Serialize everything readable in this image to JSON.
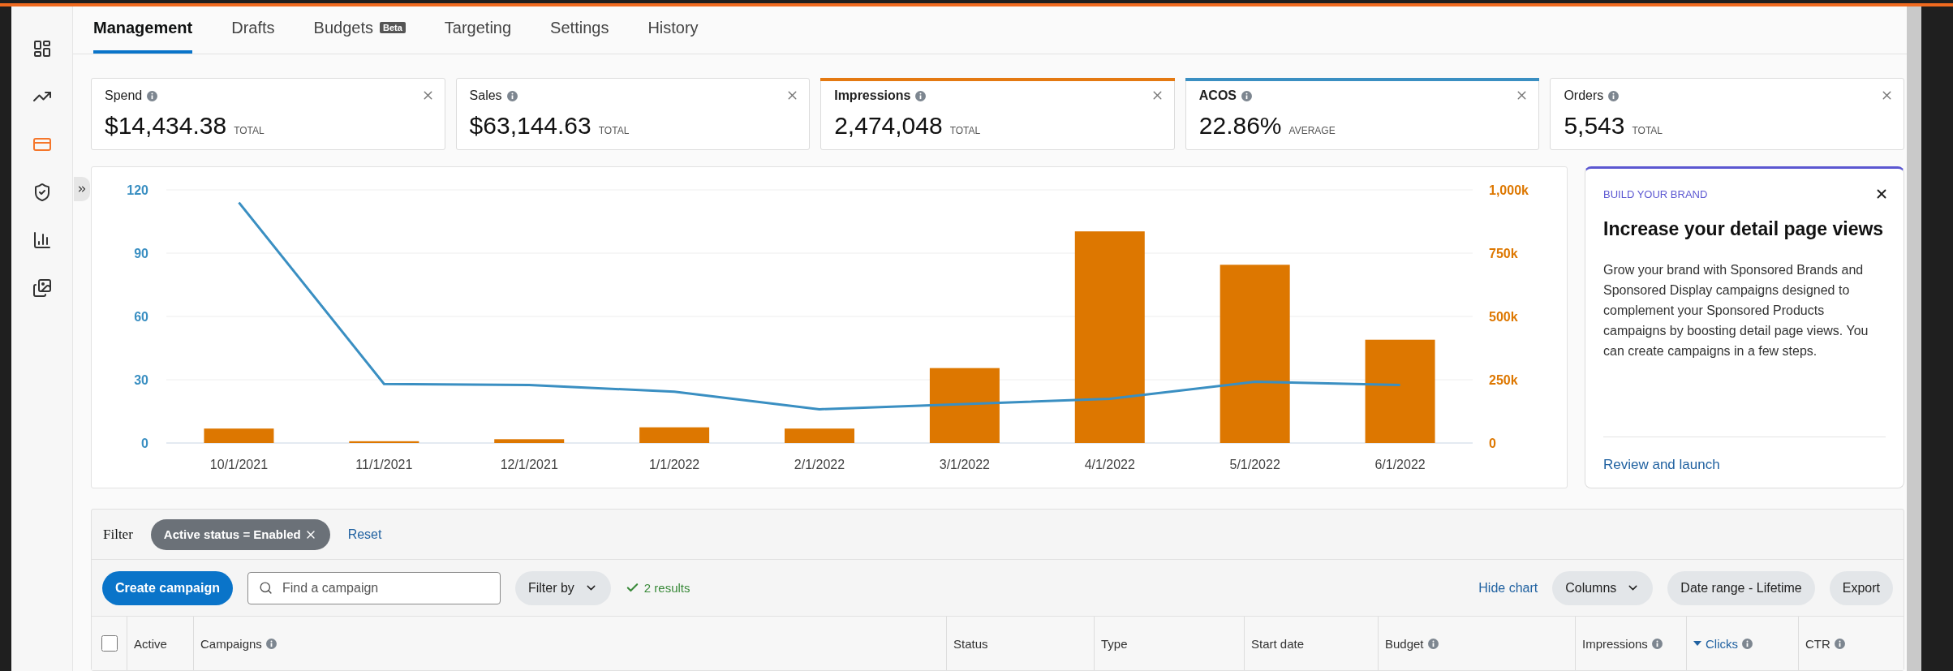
{
  "sidebar": {
    "items": [
      {
        "kind": "dashboard",
        "selected": false
      },
      {
        "kind": "trend",
        "selected": false
      },
      {
        "kind": "wallet",
        "selected": true
      },
      {
        "kind": "shield",
        "selected": false
      },
      {
        "kind": "bars",
        "selected": false
      },
      {
        "kind": "images",
        "selected": false
      }
    ]
  },
  "tabs": [
    {
      "label": "Management",
      "selected": true
    },
    {
      "label": "Drafts",
      "selected": false
    },
    {
      "label": "Budgets",
      "badge": "Beta",
      "selected": false
    },
    {
      "label": "Targeting",
      "selected": false
    },
    {
      "label": "Settings",
      "selected": false
    },
    {
      "label": "History",
      "selected": false
    }
  ],
  "metrics": [
    {
      "label": "Spend",
      "value": "$14,434.38",
      "unit": "TOTAL"
    },
    {
      "label": "Sales",
      "value": "$63,144.63",
      "unit": "TOTAL"
    },
    {
      "label": "Impressions",
      "value": "2,474,048",
      "unit": "TOTAL",
      "color": "#e47911"
    },
    {
      "label": "ACOS",
      "value": "22.86%",
      "unit": "AVERAGE",
      "color": "#3a8fc2"
    },
    {
      "label": "Orders",
      "value": "5,543",
      "unit": "TOTAL"
    }
  ],
  "chart": {
    "chart_data": {
      "type": "bar",
      "categories": [
        "10/1/2021",
        "11/1/2021",
        "12/1/2021",
        "1/1/2022",
        "2/1/2022",
        "3/1/2022",
        "4/1/2022",
        "5/1/2022",
        "6/1/2022"
      ],
      "series": [
        {
          "type": "bar",
          "axis": "y2",
          "color": "#dd7700",
          "values": [
            57000,
            7000,
            15000,
            62000,
            57000,
            296000,
            836000,
            704000,
            408000
          ]
        },
        {
          "type": "line",
          "axis": "y",
          "color": "#3a8fc2",
          "values": [
            114,
            28,
            27.5,
            24.3,
            16,
            18.5,
            21,
            29,
            27.5
          ]
        }
      ],
      "grid": true,
      "ylim": [
        0,
        120
      ],
      "y2lim": [
        0,
        1000000
      ],
      "yticks": [
        0,
        30,
        60,
        90,
        120
      ],
      "y2ticks": [
        {
          "value": 0,
          "label": "0"
        },
        {
          "value": 250000,
          "label": "250k"
        },
        {
          "value": 500000,
          "label": "500k"
        },
        {
          "value": 750000,
          "label": "750k"
        },
        {
          "value": 1000000,
          "label": "1,000k"
        }
      ]
    }
  },
  "brand_card": {
    "eyebrow": "BUILD YOUR BRAND",
    "title": "Increase your detail page views",
    "body": "Grow your brand with Sponsored Brands and Sponsored Display campaigns designed to complement your Sponsored Products campaigns by boosting detail page views. You can create campaigns in a few steps.",
    "link": "Review and launch"
  },
  "filter": {
    "label": "Filter",
    "chip": "Active status = Enabled",
    "reset": "Reset"
  },
  "toolbar": {
    "create": "Create campaign",
    "search_placeholder": "Find a campaign",
    "filter_by": "Filter by",
    "results": "2 results",
    "hide_chart": "Hide chart",
    "columns": "Columns",
    "date_range": "Date range - Lifetime",
    "export": "Export"
  },
  "table": {
    "select_all_checked": false,
    "columns": [
      {
        "label": "Active",
        "info": false,
        "sorted": false
      },
      {
        "label": "Campaigns",
        "info": true,
        "sorted": false
      },
      {
        "label": "Status",
        "info": false,
        "sorted": false
      },
      {
        "label": "Type",
        "info": false,
        "sorted": false
      },
      {
        "label": "Start date",
        "info": false,
        "sorted": false
      },
      {
        "label": "Budget",
        "info": true,
        "sorted": false
      },
      {
        "label": "Impressions",
        "info": true,
        "sorted": false
      },
      {
        "label": "Clicks",
        "info": true,
        "sorted": true
      },
      {
        "label": "CTR",
        "info": true,
        "sorted": false
      }
    ]
  }
}
